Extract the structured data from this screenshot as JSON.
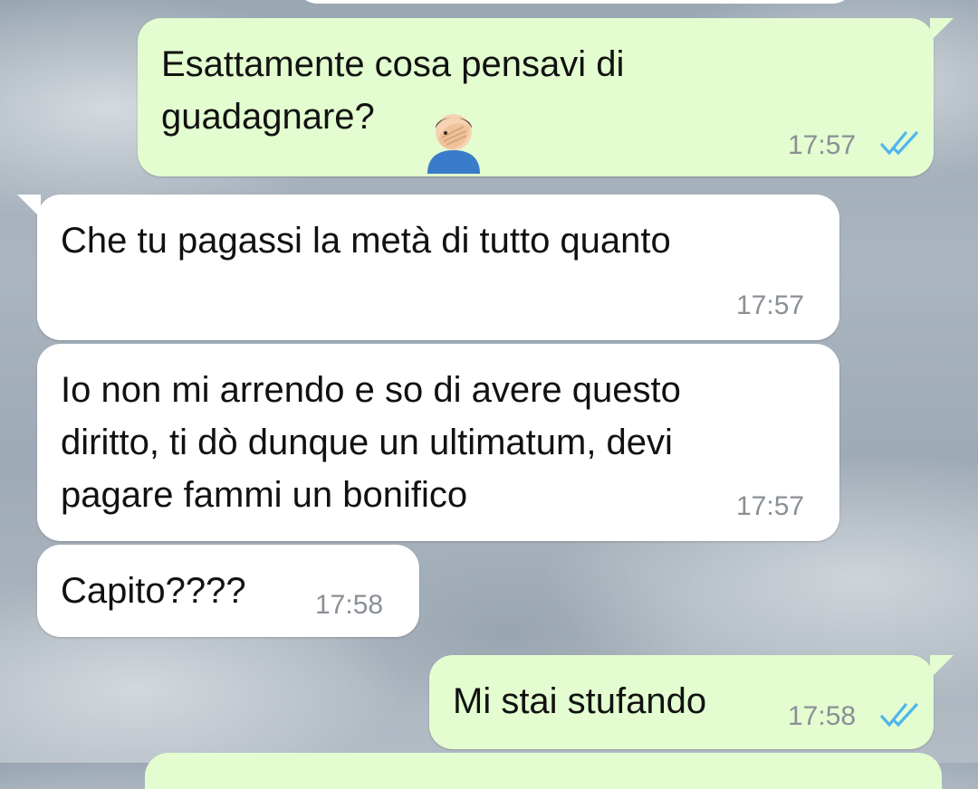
{
  "messages": [
    {
      "direction": "outgoing",
      "text": "Esattamente cosa pensavi di\nguadagnare?",
      "emoji": "facepalm-emoji",
      "time": "17:57",
      "status": "read"
    },
    {
      "direction": "incoming",
      "text": "Che tu pagassi la metà di tutto quanto",
      "time": "17:57"
    },
    {
      "direction": "incoming",
      "text": "Io non mi arrendo e so di avere questo\ndiritto, ti dò dunque un ultimatum, devi\npagare fammi un bonifico",
      "time": "17:57"
    },
    {
      "direction": "incoming",
      "text": "Capito????",
      "time": "17:58"
    },
    {
      "direction": "outgoing",
      "text": "Mi stai stufando",
      "time": "17:58",
      "status": "read"
    }
  ],
  "colors": {
    "outgoing_bubble": "#e3fdd0",
    "incoming_bubble": "#ffffff",
    "read_ticks": "#4fb6ec",
    "timestamp": "#8a9096"
  }
}
